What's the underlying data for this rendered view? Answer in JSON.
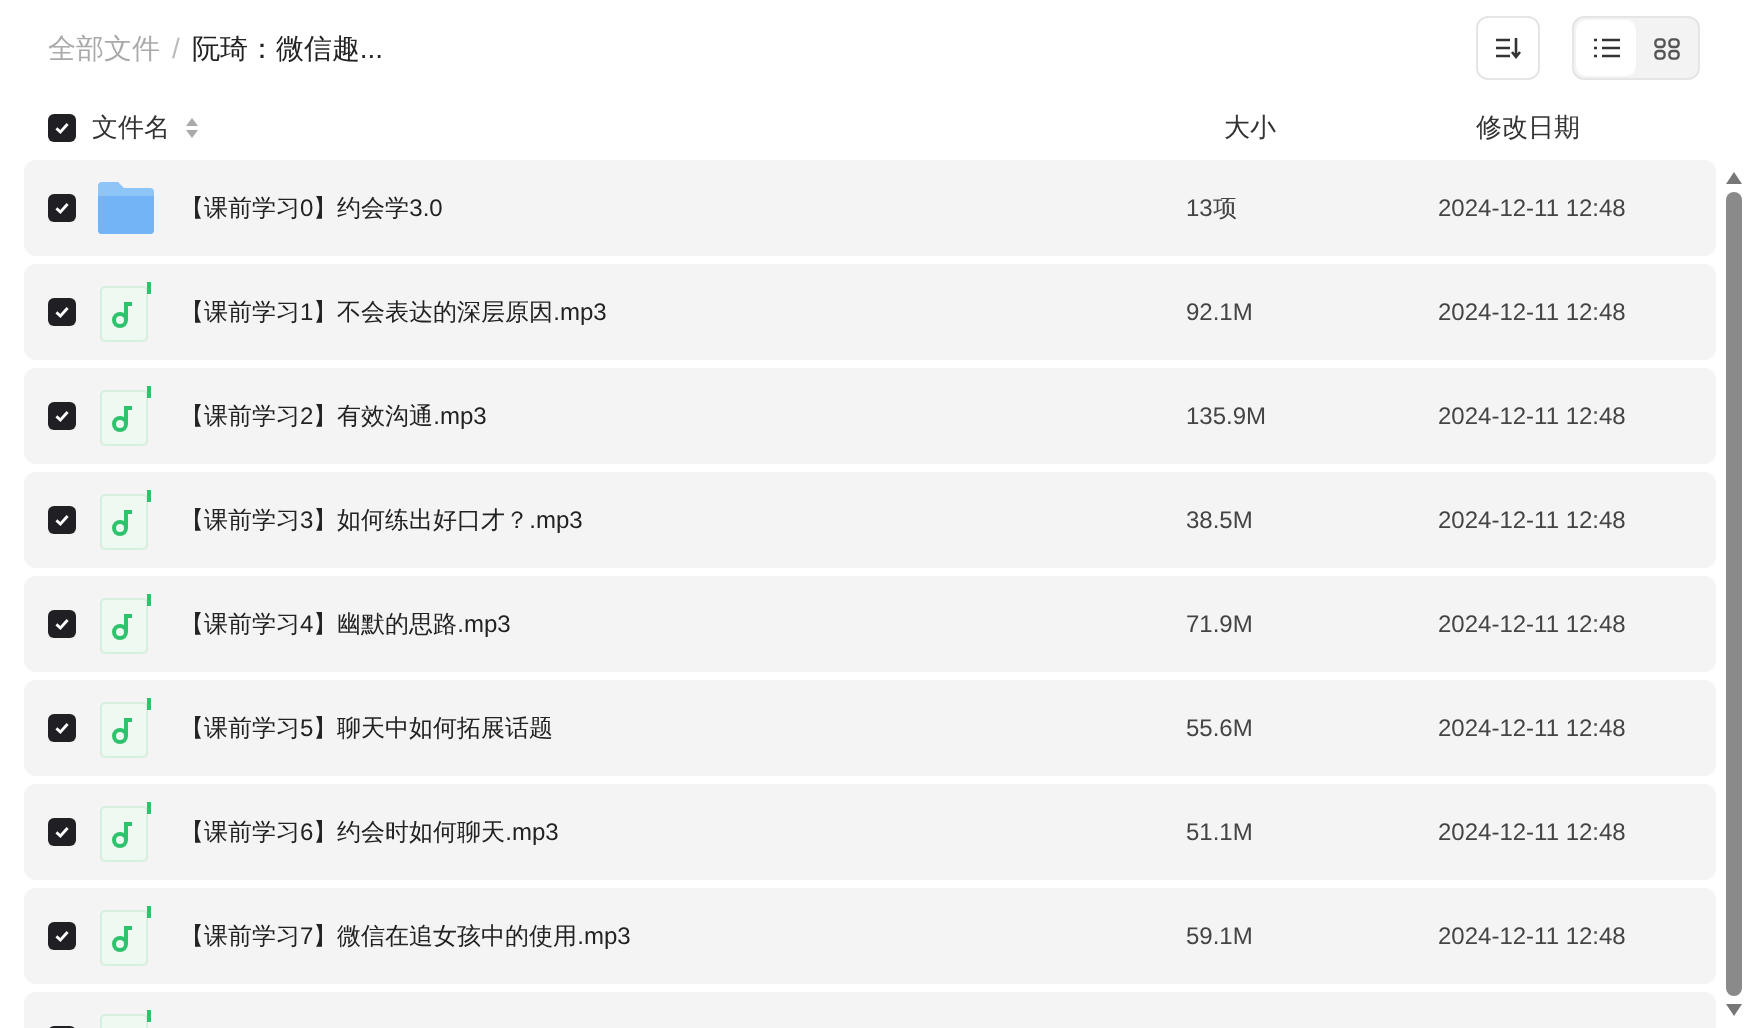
{
  "breadcrumb": [
    {
      "label": "全部文件",
      "current": false
    },
    {
      "label": "/",
      "kind": "separator"
    },
    {
      "label": "阮琦：微信趣...",
      "current": true
    }
  ],
  "view_toggle": [
    {
      "kind": "list",
      "selected": true
    },
    {
      "kind": "grid",
      "selected": false
    }
  ],
  "columns": {
    "select_all": {
      "checked": true
    },
    "name": "文件名",
    "size": "大小",
    "date": "修改日期"
  },
  "rows": [
    {
      "kind": "folder",
      "checked": true,
      "name": "【课前学习0】约会学3.0",
      "size": "13项",
      "date": "2024-12-11 12:48"
    },
    {
      "kind": "audio",
      "checked": true,
      "name": "【课前学习1】不会表达的深层原因.mp3",
      "size": "92.1M",
      "date": "2024-12-11 12:48"
    },
    {
      "kind": "audio",
      "checked": true,
      "name": "【课前学习2】有效沟通.mp3",
      "size": "135.9M",
      "date": "2024-12-11 12:48"
    },
    {
      "kind": "audio",
      "checked": true,
      "name": "【课前学习3】如何练出好口才？.mp3",
      "size": "38.5M",
      "date": "2024-12-11 12:48"
    },
    {
      "kind": "audio",
      "checked": true,
      "name": "【课前学习4】幽默的思路.mp3",
      "size": "71.9M",
      "date": "2024-12-11 12:48"
    },
    {
      "kind": "audio",
      "checked": true,
      "name": "【课前学习5】聊天中如何拓展话题",
      "size": "55.6M",
      "date": "2024-12-11 12:48"
    },
    {
      "kind": "audio",
      "checked": true,
      "name": "【课前学习6】约会时如何聊天.mp3",
      "size": "51.1M",
      "date": "2024-12-11 12:48"
    },
    {
      "kind": "audio",
      "checked": true,
      "name": "【课前学习7】微信在追女孩中的使用.mp3",
      "size": "59.1M",
      "date": "2024-12-11 12:48"
    },
    {
      "kind": "audio",
      "checked": true
    }
  ]
}
